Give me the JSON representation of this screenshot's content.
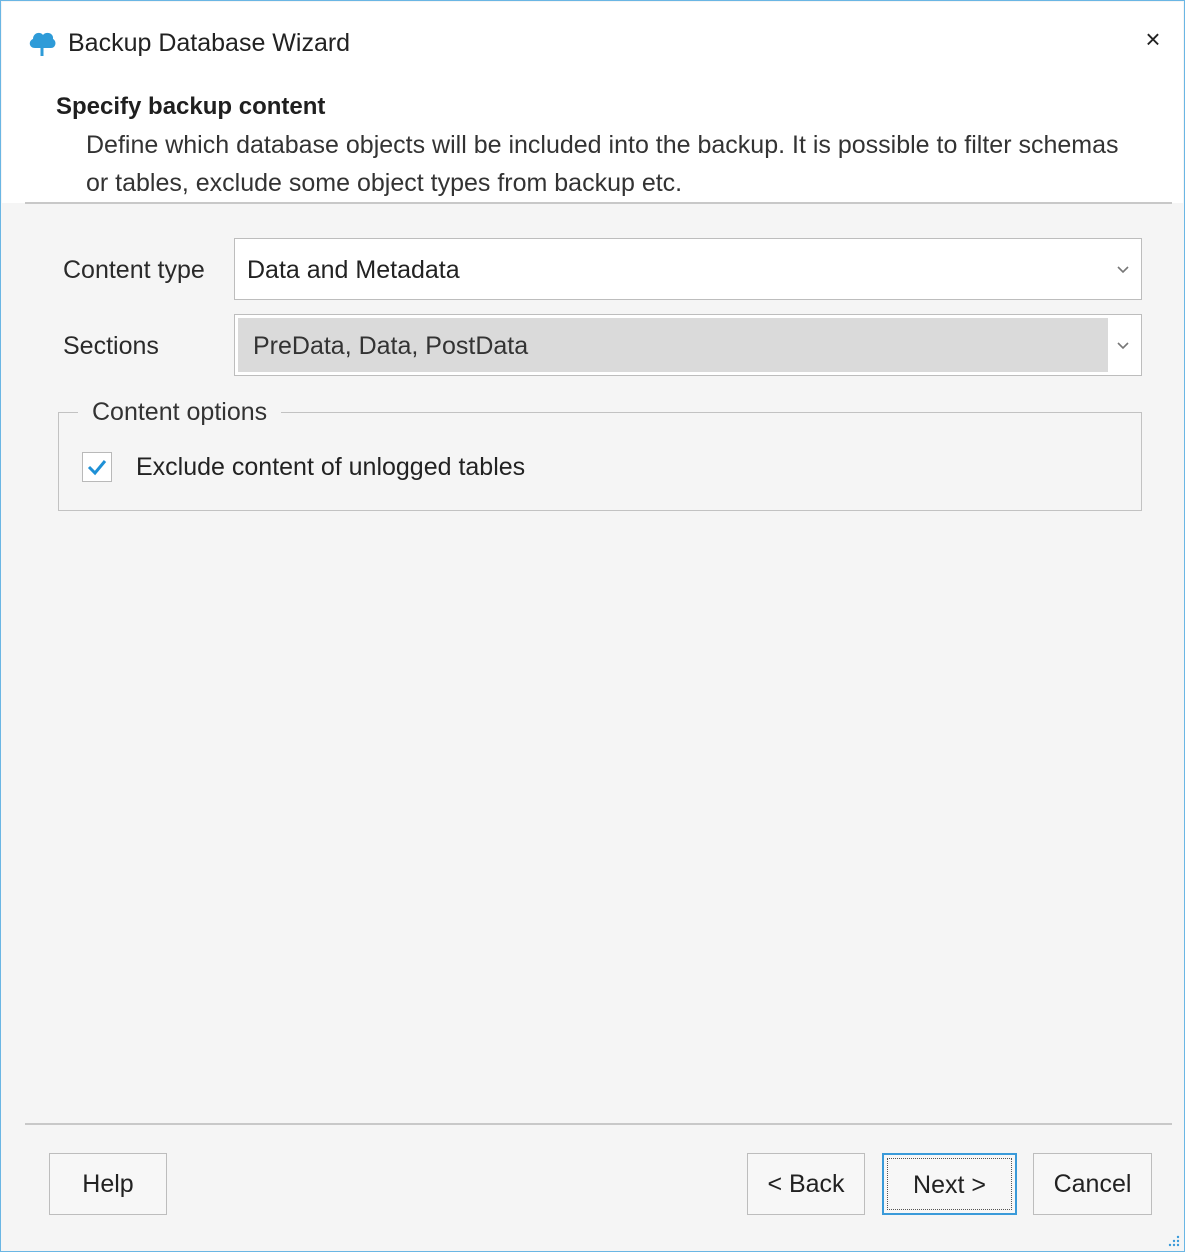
{
  "window": {
    "title": "Backup Database Wizard",
    "close_glyph": "×",
    "accent_color": "#3a9ad9",
    "icon": "cloud-tree-icon"
  },
  "header": {
    "step_title": "Specify backup content",
    "step_description": "Define which database objects will be included into the backup. It is possible to filter schemas or tables, exclude some object types from backup etc."
  },
  "form": {
    "content_type": {
      "label": "Content type",
      "value": "Data and Metadata"
    },
    "sections": {
      "label": "Sections",
      "value": "PreData, Data, PostData",
      "enabled": false
    },
    "content_options": {
      "legend": "Content options",
      "exclude_unlogged": {
        "label": "Exclude content of unlogged tables",
        "checked": true
      }
    }
  },
  "footer": {
    "help_label": "Help",
    "back_label": "< Back",
    "next_label": "Next >",
    "cancel_label": "Cancel"
  }
}
